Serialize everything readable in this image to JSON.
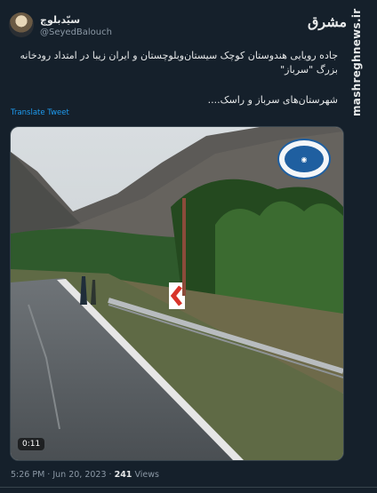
{
  "tweet": {
    "display_name": "سیّدبلوچ",
    "handle": "@SeyedBalouch",
    "text_line1": "جاده رویایی هندوستان کوچک سیستان‌وبلوچستان و ایران زیبا در امتداد رودخانه",
    "text_line2": "بزرگ \"سرباز\"",
    "text_line3": "شهرستان‌های سرباز و راسک....",
    "translate_label": "Translate Tweet",
    "media": {
      "duration": "0:11",
      "channel_logo_icon": "channel-logo"
    },
    "time": "5:26 PM",
    "date_separator": " · ",
    "date": "Jun 20, 2023",
    "views_count": "241",
    "views_label": "Views"
  },
  "watermark": {
    "logo_text": "مشرق",
    "site": "mashreghnews.ir"
  },
  "colors": {
    "background": "#15202b",
    "link": "#1d9bf0",
    "secondary_text": "#8b98a5"
  }
}
